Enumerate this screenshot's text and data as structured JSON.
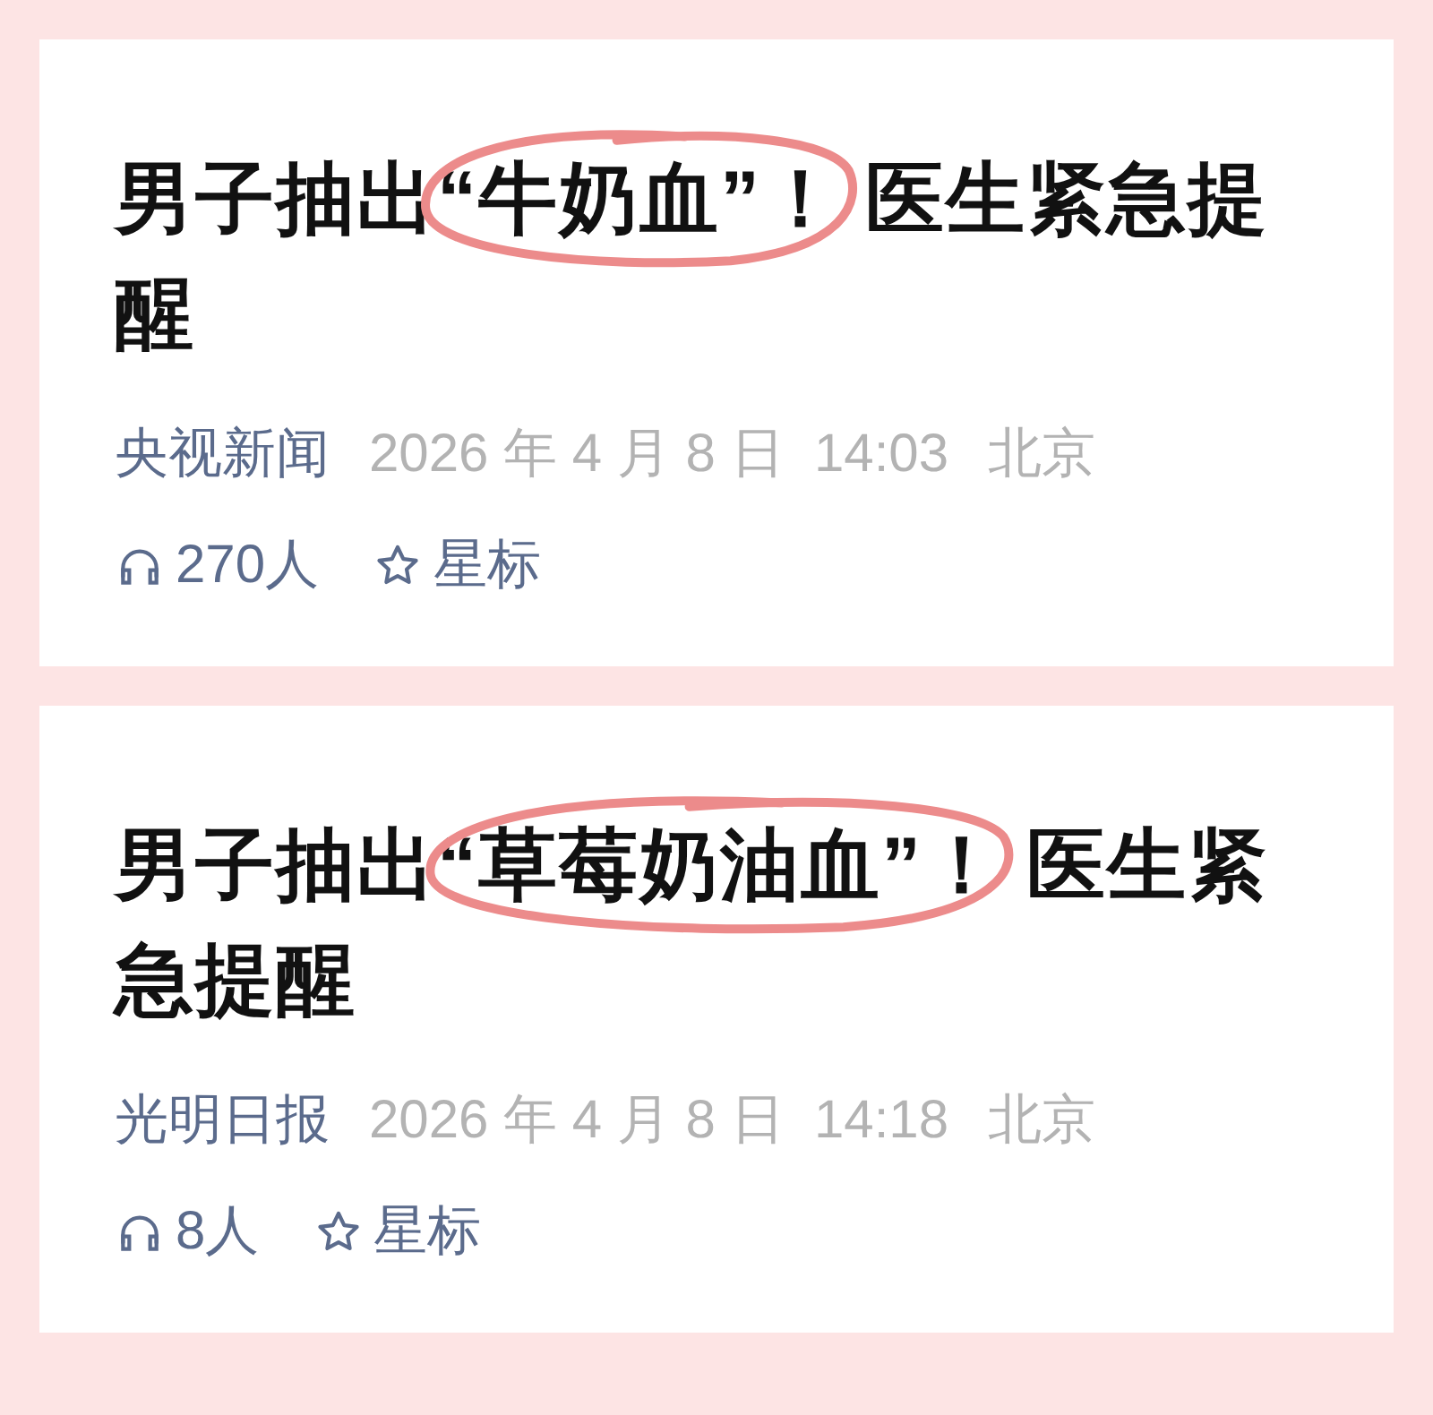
{
  "articles": [
    {
      "title": {
        "before": "男子抽出",
        "circled": "“牛奶血”！",
        "after": " 医生紧急提醒"
      },
      "source": "央视新闻",
      "date": "2026 年 4 月 8 日  14:03",
      "location": "北京",
      "listeners": "270人",
      "star_label": "星标"
    },
    {
      "title": {
        "before": "男子抽出",
        "circled": "“草莓奶油血”！",
        "after": " 医生紧急提醒"
      },
      "source": "光明日报",
      "date": "2026 年 4 月 8 日  14:18",
      "location": "北京",
      "listeners": "8人",
      "star_label": "星标"
    }
  ]
}
